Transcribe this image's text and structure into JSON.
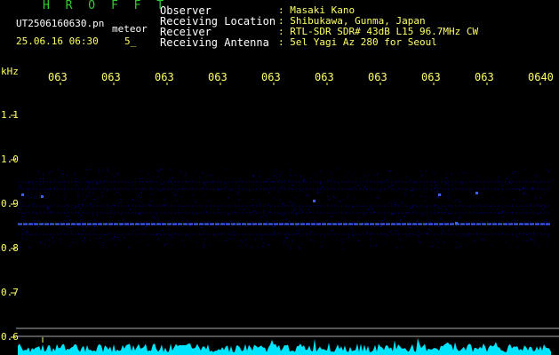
{
  "header": {
    "program_title": "H R O F F T",
    "filename": "UT2506160630.pn",
    "kind_label": "meteor",
    "date_time": "25.06.16 06:30",
    "count_label": "5_"
  },
  "info": {
    "rows": [
      {
        "key": "Observer",
        "value": ": Masaki Kano"
      },
      {
        "key": "Receiving Location",
        "value": ": Shibukawa, Gunma, Japan"
      },
      {
        "key": "Receiver",
        "value": ": RTL-SDR SDR# 43dB L15 96.7MHz CW"
      },
      {
        "key": "Receiving Antenna",
        "value": ": 5el Yagi Az 280 for Seoul"
      }
    ]
  },
  "chart_data": {
    "type": "heatmap",
    "ylabel": "kHz",
    "y_ticks": [
      "1.1",
      "1.0",
      "0.9",
      "0.8",
      "0.7",
      "0.6"
    ],
    "x_ticks": [
      "063",
      "063",
      "063",
      "063",
      "063",
      "063",
      "063",
      "063",
      "063",
      "0640"
    ],
    "ylim": [
      0.6,
      1.1
    ],
    "grid": false,
    "colors": {
      "background": "#000000",
      "tick": "#ffff66",
      "signal_low": "#0000aa",
      "signal_high": "#3f5fff",
      "power_trace": "#00e5ff",
      "boundary_lines": "#aaaaaa"
    }
  }
}
